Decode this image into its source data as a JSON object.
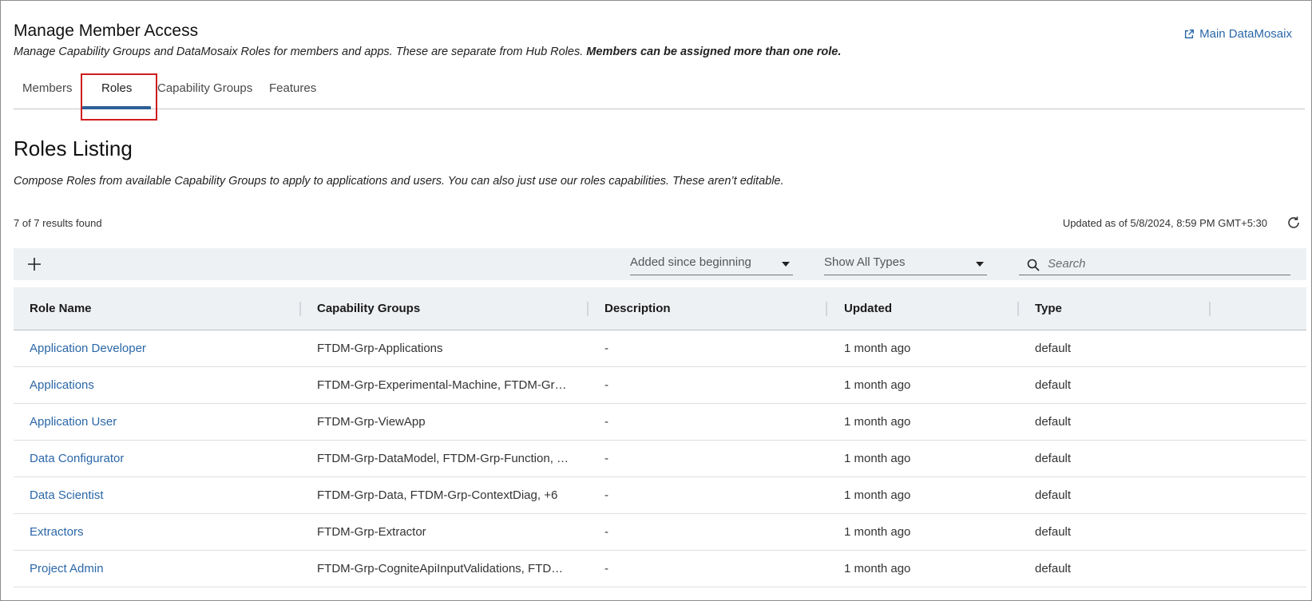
{
  "header": {
    "title": "Manage Member Access",
    "subtitle_plain": "Manage Capability Groups and DataMosaix Roles for members and apps. These are separate from Hub Roles. ",
    "subtitle_bold": "Members can be assigned more than one role.",
    "main_link_label": "Main DataMosaix",
    "main_link_icon": "external-link-icon"
  },
  "tabs": [
    {
      "label": "Members",
      "active": false
    },
    {
      "label": "Roles",
      "active": true
    },
    {
      "label": "Capability Groups",
      "active": false
    },
    {
      "label": "Features",
      "active": false
    }
  ],
  "section": {
    "title": "Roles Listing",
    "description": "Compose Roles from available Capability Groups to apply to applications and users. You can also just use our roles capabilities. These aren’t editable."
  },
  "meta": {
    "results": "7 of 7 results found",
    "updated": "Updated as of 5/8/2024, 8:59 PM GMT+5:30",
    "refresh_icon": "refresh-icon"
  },
  "toolbar": {
    "add_icon": "plus-icon",
    "date_filter": "Added since beginning",
    "type_filter": "Show All Types",
    "search_placeholder": "Search",
    "search_icon": "search-icon"
  },
  "table": {
    "columns": [
      "Role Name",
      "Capability Groups",
      "Description",
      "Updated",
      "Type"
    ],
    "rows": [
      {
        "name": "Application Developer",
        "groups": "FTDM-Grp-Applications",
        "description": "-",
        "updated": "1 month ago",
        "type": "default"
      },
      {
        "name": "Applications",
        "groups": "FTDM-Grp-Experimental-Machine, FTDM-Gr…",
        "description": "-",
        "updated": "1 month ago",
        "type": "default"
      },
      {
        "name": "Application User",
        "groups": "FTDM-Grp-ViewApp",
        "description": "-",
        "updated": "1 month ago",
        "type": "default"
      },
      {
        "name": "Data Configurator",
        "groups": "FTDM-Grp-DataModel, FTDM-Grp-Function, …",
        "description": "-",
        "updated": "1 month ago",
        "type": "default"
      },
      {
        "name": "Data Scientist",
        "groups": "FTDM-Grp-Data, FTDM-Grp-ContextDiag, +6",
        "description": "-",
        "updated": "1 month ago",
        "type": "default"
      },
      {
        "name": "Extractors",
        "groups": "FTDM-Grp-Extractor",
        "description": "-",
        "updated": "1 month ago",
        "type": "default"
      },
      {
        "name": "Project Admin",
        "groups": "FTDM-Grp-CogniteApiInputValidations, FTD…",
        "description": "-",
        "updated": "1 month ago",
        "type": "default"
      }
    ]
  },
  "colors": {
    "link": "#2b67a8",
    "tab_underline": "#2e5f97",
    "highlight": "#cf1c1c",
    "toolbar_bg": "#eef1f4"
  }
}
